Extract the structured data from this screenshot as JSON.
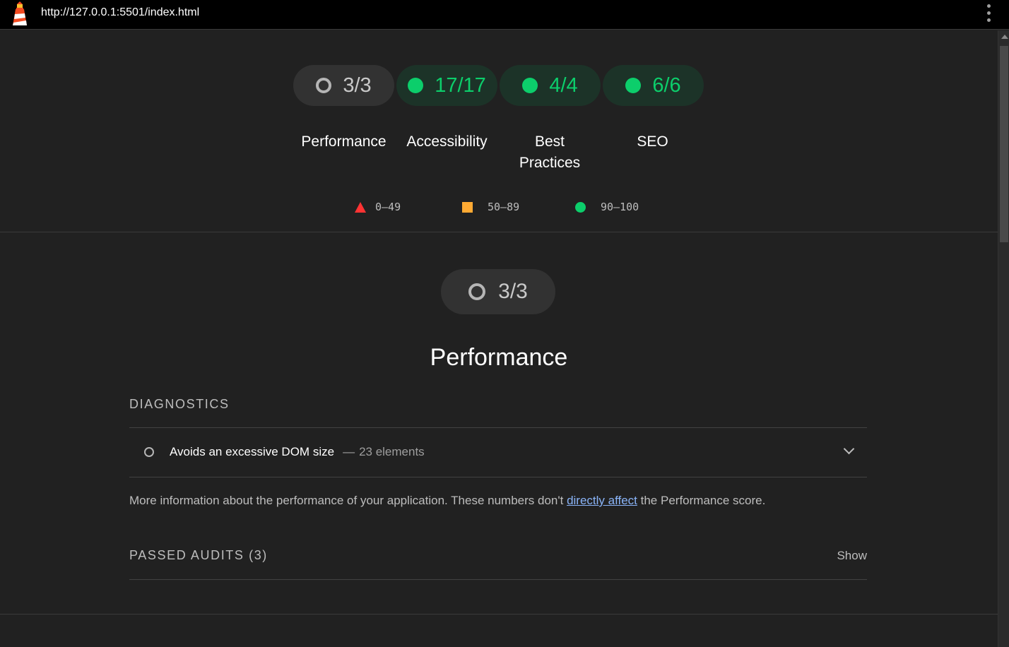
{
  "browser": {
    "url": "http://127.0.0.1:5501/index.html"
  },
  "summary": {
    "gauges": [
      {
        "score": "3/3",
        "label": "Performance",
        "status": "informative"
      },
      {
        "score": "17/17",
        "label": "Accessibility",
        "status": "pass"
      },
      {
        "score": "4/4",
        "label": "Best Practices",
        "status": "pass"
      },
      {
        "score": "6/6",
        "label": "SEO",
        "status": "pass"
      }
    ],
    "legend": [
      {
        "range": "0–49",
        "shape": "triangle",
        "color": "#ff3333"
      },
      {
        "range": "50–89",
        "shape": "square",
        "color": "#ffaa33"
      },
      {
        "range": "90–100",
        "shape": "circle",
        "color": "#0cce6b"
      }
    ]
  },
  "performance": {
    "score": "3/3",
    "title": "Performance",
    "diagnostics_title": "DIAGNOSTICS",
    "audit": {
      "title": "Avoids an excessive DOM size",
      "separator": "—",
      "value": "23 elements"
    },
    "description_before": "More information about the performance of your application. These numbers don't ",
    "description_link": "directly affect",
    "description_after": " the Performance score.",
    "passed_title": "PASSED AUDITS (3)",
    "show_label": "Show"
  },
  "colors": {
    "background": "#212121",
    "pass": "#0cce6b",
    "average": "#ffaa33",
    "fail": "#ff3333",
    "link": "#8ab4f8"
  }
}
